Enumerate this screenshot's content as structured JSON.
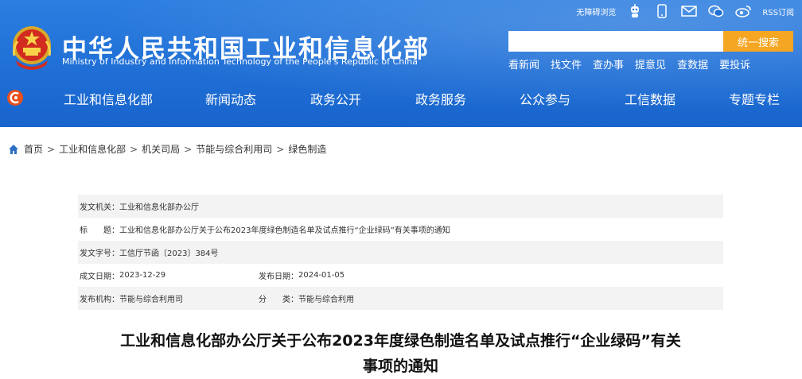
{
  "colors": {
    "header_blue": "#1f6fd6",
    "search_button": "#f5a623",
    "meta_shade": "#f3f3f3"
  },
  "topbar": {
    "accessibility": "无障碍浏览",
    "icons": [
      "robot-icon",
      "mobile-icon",
      "mail-icon",
      "wechat-icon",
      "weibo-icon"
    ],
    "rss": "RSS订阅"
  },
  "header": {
    "title": "中华人民共和国工业和信息化部",
    "subtitle": "Ministry of Industry and Information Technology of the People's Republic of China"
  },
  "search": {
    "placeholder": "",
    "button": "统一搜索"
  },
  "quick_links": [
    "看新闻",
    "找文件",
    "查办事",
    "提意见",
    "查数据",
    "要投诉"
  ],
  "nav": [
    "工业和信息化部",
    "新闻动态",
    "政务公开",
    "政务服务",
    "公众参与",
    "工信数据",
    "专题专栏"
  ],
  "breadcrumb": [
    "首页",
    "工业和信息化部",
    "机关司局",
    "节能与综合利用司",
    "绿色制造"
  ],
  "meta": {
    "issuer_label": "发文机关：",
    "issuer": "工业和信息化部办公厅",
    "title_label": "标　　题：",
    "title": "工业和信息化部办公厅关于公布2023年度绿色制造名单及试点推行“企业绿码”有关事项的通知",
    "doc_no_label": "发文字号：",
    "doc_no": "工信厅节函〔2023〕384号",
    "written_label": "成文日期：",
    "written": "2023-12-29",
    "published_label": "发布日期：",
    "published": "2024-01-05",
    "publisher_label": "发布机构：",
    "publisher": "节能与综合利用司",
    "category_label": "分　　类：",
    "category": "节能与综合利用"
  },
  "article": {
    "title_line1": "工业和信息化部办公厅关于公布2023年度绿色制造名单及试点推行“企业绿码”有关",
    "title_line2": "事项的通知"
  }
}
